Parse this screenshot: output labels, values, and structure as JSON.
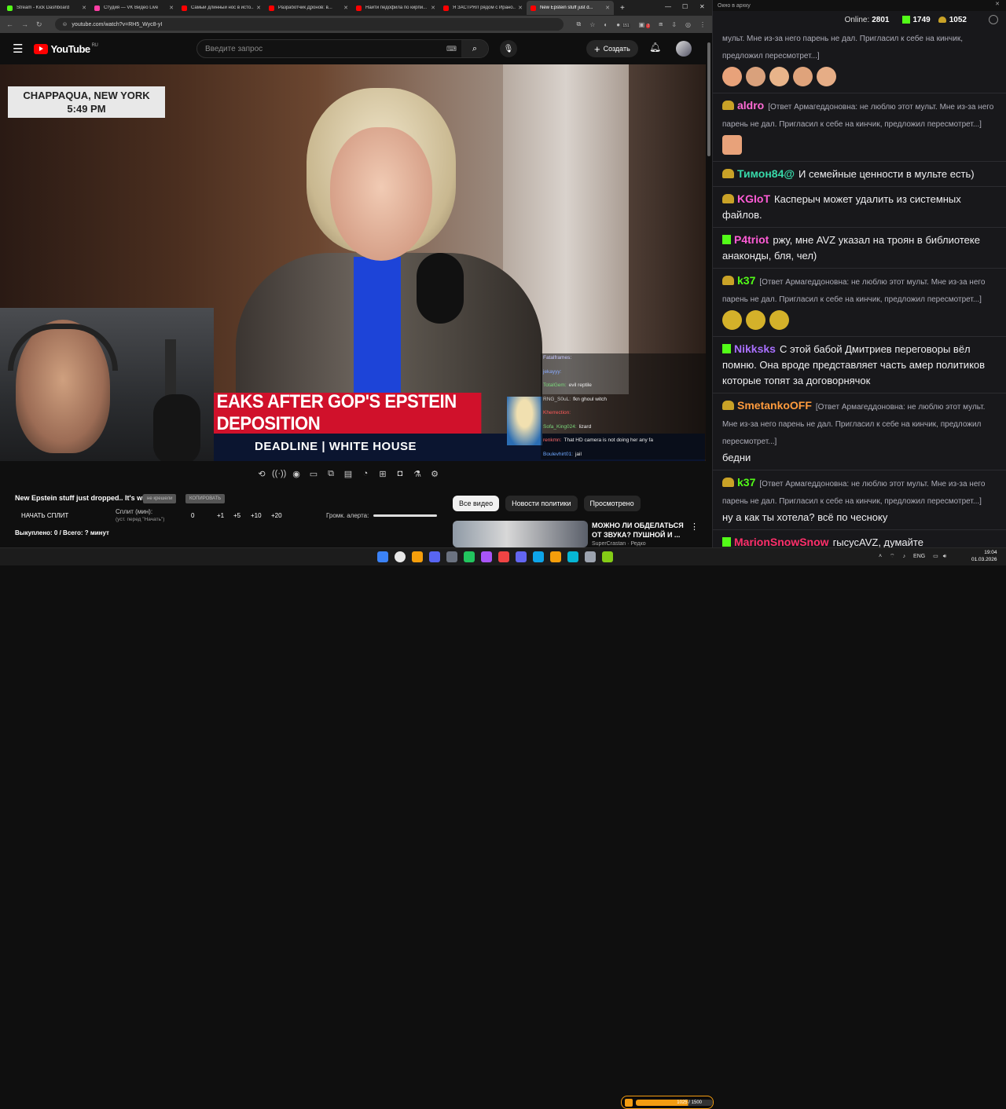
{
  "browser": {
    "tabs": [
      {
        "title": "Stream - Kick Dashboard",
        "color": "#53fc18"
      },
      {
        "title": "Студия — VK Видео Live",
        "color": "#ff3ea5"
      },
      {
        "title": "Самый длинный нос в исто...",
        "color": "#ff0000"
      },
      {
        "title": "Разработчик Дронов: в...",
        "color": "#ff0000"
      },
      {
        "title": "Найти педофила по кирпи...",
        "color": "#ff0000"
      },
      {
        "title": "Я ЗАСТРЯЛ рядом с Ирано...",
        "color": "#ff0000"
      },
      {
        "title": "New Epstein stuff just d...",
        "color": "#ff0000"
      }
    ],
    "url": "youtube.com/watch?v=RH5_Wyc8-yI",
    "ext_count_1": "151",
    "ext_count_2": "2"
  },
  "youtube": {
    "logo_text": "YouTube",
    "region": "RU",
    "search_placeholder": "Введите запрос",
    "create_label": "Создать"
  },
  "video": {
    "location": "CHAPPAQUA, NEW YORK",
    "time": "5:49 PM",
    "chyron": "EAKS AFTER GOP'S EPSTEIN DEPOSITION",
    "chyron_sub": "DEADLINE | WHITE HOUSE",
    "overlay_chat": [
      {
        "user": "Fatalframes:",
        "text": "",
        "color": "#c8c8ff"
      },
      {
        "user": "jekayyy:",
        "text": "",
        "color": "#88aaff"
      },
      {
        "user": "TotalGem:",
        "text": "evil reptile",
        "color": "#7bd77b"
      },
      {
        "user": "RNG_S0uL:",
        "text": "fkn ghoul witch",
        "color": "#cccccc"
      },
      {
        "user": "Kherrection:",
        "text": "",
        "color": "#ff5a5a"
      },
      {
        "user": "Sofa_King024:",
        "text": "lizard",
        "color": "#7bd77b"
      },
      {
        "user": "renkmn:",
        "text": "That HD camera is not doing her any fa",
        "color": "#ff6b6b"
      },
      {
        "user": "Boulevhirt01:",
        "text": "jail",
        "color": "#6fa8ff"
      }
    ]
  },
  "below_player": {
    "title": "New Epstein stuff just dropped.. It's wild",
    "pill_1": "не крешели",
    "pill_2": "КОПИРОВАТЬ",
    "start_split": "НАЧАТЬ СПЛИТ",
    "split_label": "Сплит (мин):",
    "split_sub": "(уст. перед \"Начать\")",
    "split_values": [
      "0",
      "+1",
      "+5",
      "+10",
      "+20"
    ],
    "volume_label": "Громк. алерта:",
    "bought": "Выкуплено: 0 / Всего: ? минут"
  },
  "chips": [
    "Все видео",
    "Новости политики",
    "Просмотрено"
  ],
  "recommendation": {
    "title": "МОЖНО ЛИ ОБДЕЛАТЬСЯ ОТ ЗВУКА? ПУШНОЙ И ...",
    "channel": "SuperCrastan",
    "views": "Редко"
  },
  "chat": {
    "window_title": "Окно в архку",
    "online_label": "Online:",
    "online_count": "2801",
    "stat_kick": "1749",
    "stat_other": "1052",
    "messages": [
      {
        "type": "cont",
        "reply": "мульт. Мне из-за него парень не дал. Пригласил к себе на кинчик, предложил пересмотрет...]",
        "emotes": 5
      },
      {
        "type": "msg",
        "badge": "verified",
        "user": "aldro",
        "color": "#ff6bd5",
        "reply": "[Ответ Армагеддоновна: не люблю этот мульт. Мне из-за него парень не дал. Пригласил к себе на кинчик, предложил пересмотрет...]",
        "text": "",
        "emotes": 1
      },
      {
        "type": "msg",
        "badge": "verified",
        "user": "Тимон84@",
        "color": "#38d9a9",
        "reply": "",
        "text": "И семейные ценности в мульте есть)",
        "emotes": 0
      },
      {
        "type": "msg",
        "badge": "verified",
        "user": "KGIoT",
        "color": "#ff5cd6",
        "reply": "",
        "text": "Касперыч может удалить из системных файлов.",
        "emotes": 0
      },
      {
        "type": "msg",
        "badge": "kick",
        "user": "P4triot",
        "color": "#ff5cd6",
        "reply": "",
        "text": "ржу, мне AVZ указал на троян в библиотеке анаконды, бля, чел)",
        "emotes": 0
      },
      {
        "type": "msg",
        "badge": "verified",
        "user": "k37",
        "color": "#53fc18",
        "reply": "[Ответ Армагеддоновна: не люблю этот мульт. Мне из-за него парень не дал. Пригласил к себе на кинчик, предложил пересмотрет...]",
        "text": "",
        "emotes": 3
      },
      {
        "type": "msg",
        "badge": "kick",
        "user": "Nikksks",
        "color": "#a970ff",
        "reply": "",
        "text": "С этой бабой Дмитриев переговоры вёл помню. Она вроде представляет часть амер политиков которые топят за договорнячок",
        "emotes": 0
      },
      {
        "type": "msg",
        "badge": "verified",
        "user": "SmetankoOFF",
        "color": "#ff9b3d",
        "reply": "[Ответ Армагеддоновна: не люблю этот мульт. Мне из-за него парень не дал. Пригласил к себе на кинчик, предложил пересмотрет...]",
        "text": "бедни",
        "emotes": 0
      },
      {
        "type": "msg",
        "badge": "verified",
        "user": "k37",
        "color": "#53fc18",
        "reply": "[Ответ Армагеддоновна: не люблю этот мульт. Мне из-за него парень не дал. Пригласил к себе на кинчик, предложил пересмотрет...]",
        "text": "ну а как ты хотела? всё по чесноку",
        "emotes": 0
      },
      {
        "type": "msg",
        "badge": "kick",
        "user": "MarionSnowSnow",
        "color": "#ff2f6a",
        "reply": "",
        "text": "гысусAVZ, думайте",
        "emotes": 0
      }
    ]
  },
  "taskbar": {
    "lang": "ENG",
    "time": "19:04",
    "date": "01.03.2026",
    "progress_text": "1025 / 1500"
  }
}
